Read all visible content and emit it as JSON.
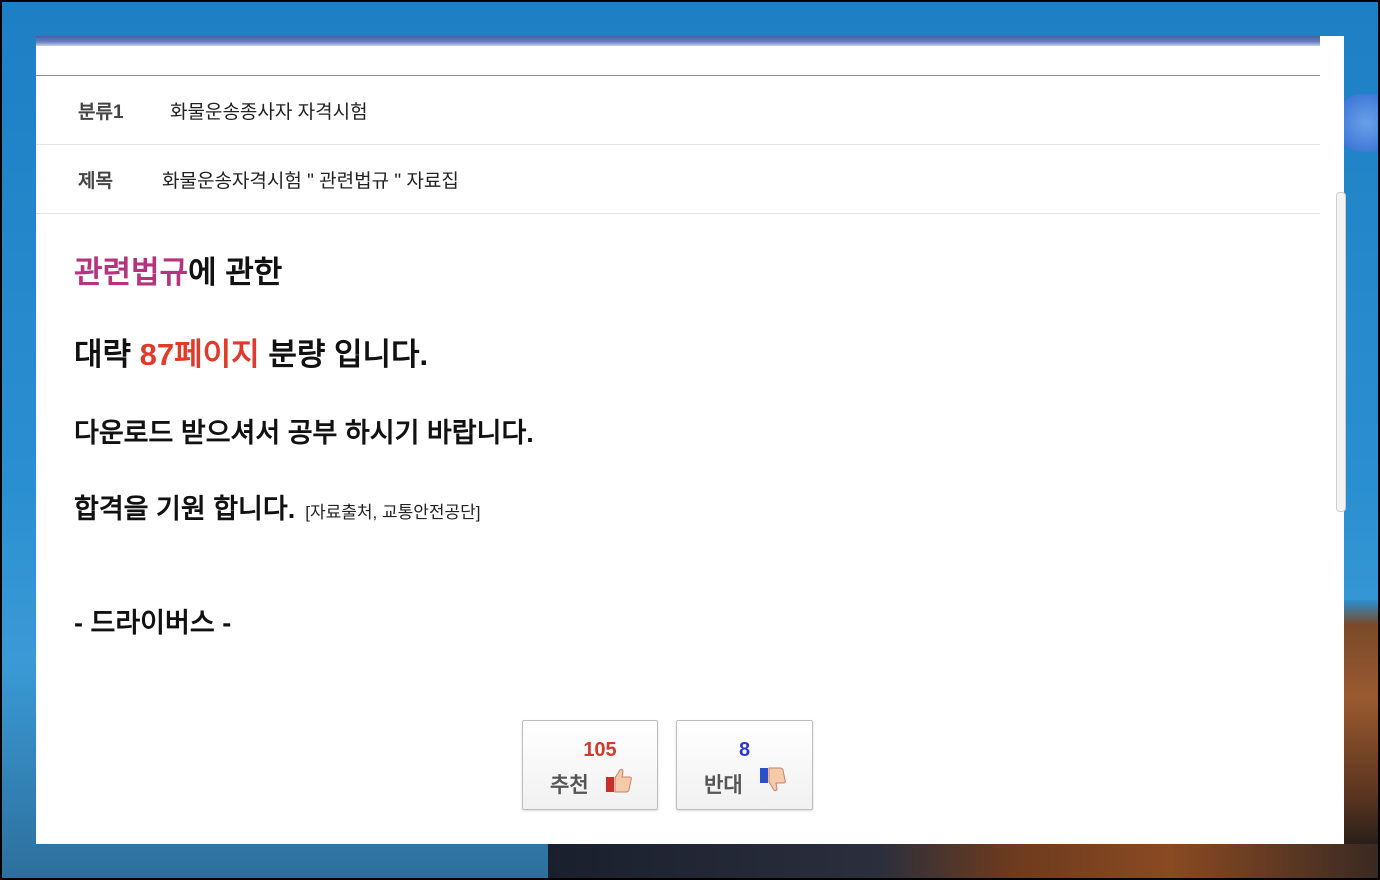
{
  "meta_row": {
    "category_label": "분류1",
    "category_value": "화물운송종사자 자격시험",
    "title_label": "제목",
    "title_value": "화물운송자격시험 \" 관련법규 \" 자료집"
  },
  "body": {
    "line1_highlight": "관련법규",
    "line1_rest": "에 관한",
    "line2_prefix": "대략 ",
    "line2_highlight": "87페이지",
    "line2_suffix": " 분량 입니다.",
    "line3": "다운로드 받으셔서 공부 하시기 바랍니다.",
    "line4": "합격을 기원 합니다.",
    "line4_note": "[자료출처, 교통안전공단]",
    "signature": "- 드라이버스 -"
  },
  "votes": {
    "up_count": "105",
    "up_label": "추천",
    "up_icon": "thumbs-up-icon",
    "down_count": "8",
    "down_label": "반대",
    "down_icon": "thumbs-down-icon"
  },
  "colors": {
    "highlight_purple": "#b5337f",
    "highlight_red": "#e03a2a",
    "vote_up": "#d23a2a",
    "vote_down": "#2a3ad2"
  }
}
